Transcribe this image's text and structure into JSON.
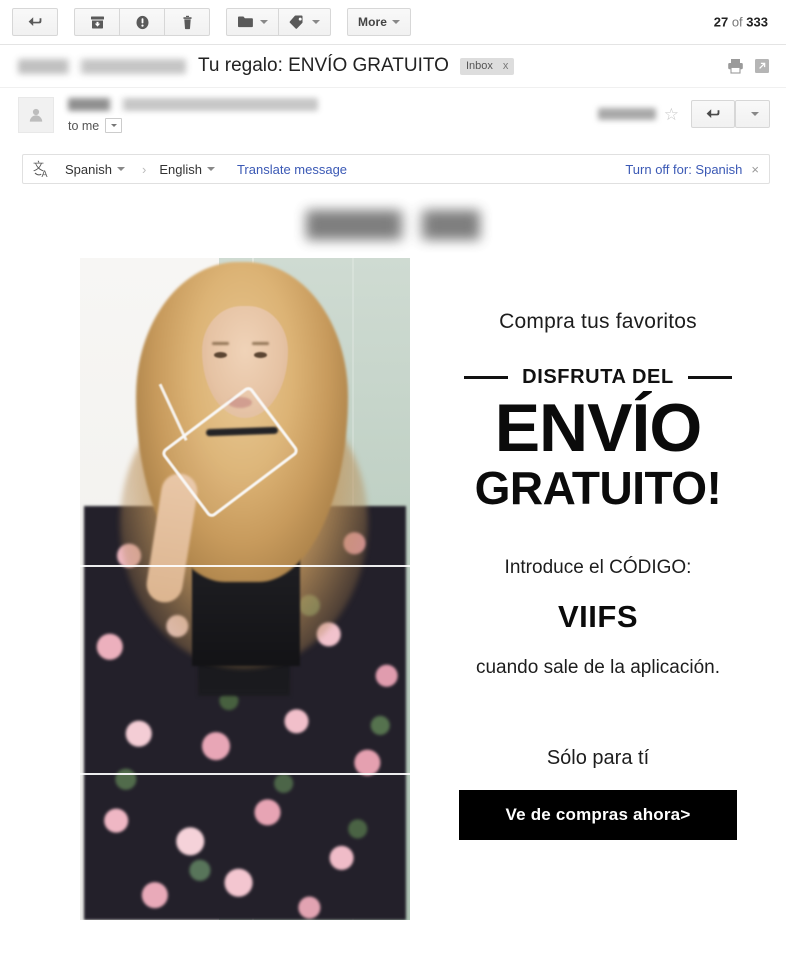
{
  "toolbar": {
    "back_icon": "back-arrow-icon",
    "archive_icon": "archive-icon",
    "spam_icon": "report-spam-icon",
    "delete_icon": "trash-icon",
    "move_icon": "move-to-folder-icon",
    "labels_icon": "labels-tag-icon",
    "more_label": "More",
    "counter_current": "27",
    "counter_separator": "of",
    "counter_total": "333"
  },
  "subject": {
    "title": "Tu regalo: ENVÍO GRATUITO",
    "label_chip": "Inbox",
    "label_chip_remove": "x",
    "print_icon": "print-icon",
    "popout_icon": "open-in-new-window-icon"
  },
  "sender": {
    "avatar_icon": "person-avatar-icon",
    "to_line": "to me",
    "star_icon": "star-icon",
    "reply_icon": "reply-icon",
    "more_options_icon": "chevron-down-icon"
  },
  "translate": {
    "icon": "translate-icon",
    "source_language": "Spanish",
    "arrow": "›",
    "target_language": "English",
    "action_link": "Translate message",
    "turn_off_link": "Turn off for: Spanish",
    "close": "×"
  },
  "email": {
    "hero_image_alt": "fashion-model-floral-outfit-photo",
    "headline_small": "Compra tus favoritos",
    "eyebrow": "DISFRUTA DEL",
    "headline_big_line1": "ENVÍO",
    "headline_big_line2": "GRATUITO!",
    "code_intro": "Introduce el CÓDIGO:",
    "code_value": "VIIFS",
    "code_note": "cuando sale de la aplicación.",
    "closing": "Sólo para tí",
    "cta_label": "Ve de compras ahora>"
  },
  "colors": {
    "cta_background": "#000000",
    "cta_text": "#ffffff",
    "link": "#3b59b5",
    "chip_background": "#dddddd"
  }
}
